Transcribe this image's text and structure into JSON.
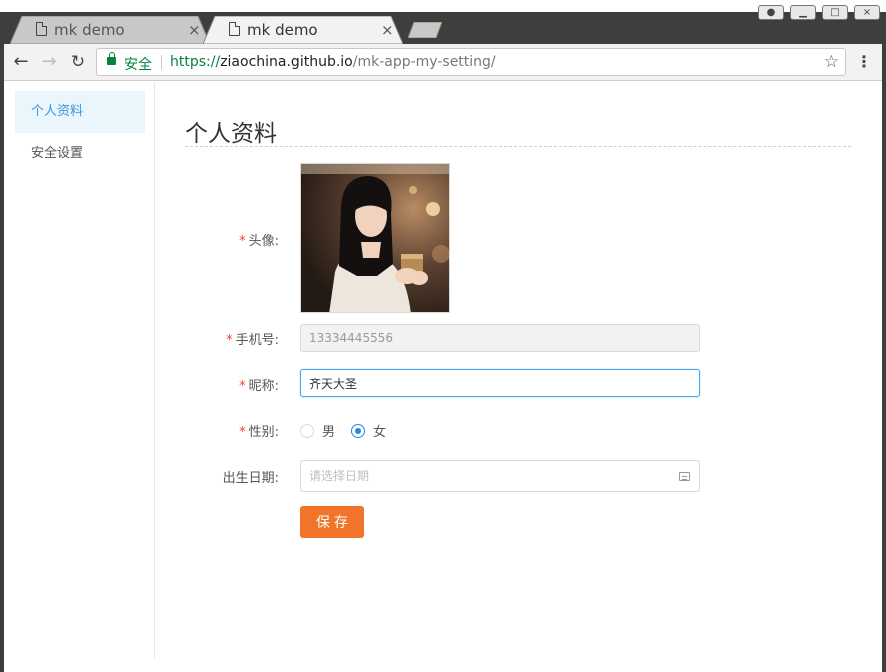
{
  "browser": {
    "tabs": [
      {
        "label": "mk demo",
        "active": false
      },
      {
        "label": "mk demo",
        "active": true
      }
    ],
    "tab_close": "×",
    "secure_label": "安全",
    "url": {
      "scheme": "https://",
      "host": "ziaochina.github.io",
      "path": "/mk-app-my-setting/"
    },
    "nav": {
      "back": "←",
      "forward": "→",
      "reload": "↻",
      "star": "☆",
      "menu": "⋮"
    }
  },
  "sidebar": {
    "items": [
      {
        "label": "个人资料",
        "active": true
      },
      {
        "label": "安全设置",
        "active": false
      }
    ]
  },
  "main": {
    "title": "个人资料",
    "required_mark": "*",
    "avatar": {
      "label": "头像:"
    },
    "phone": {
      "label": "手机号:",
      "value": "13334445556",
      "disabled": true
    },
    "nickname": {
      "label": "昵称:",
      "value": "齐天大圣"
    },
    "gender": {
      "label": "性别:",
      "options": [
        {
          "label": "男",
          "checked": false
        },
        {
          "label": "女",
          "checked": true
        }
      ]
    },
    "birthday": {
      "label": "出生日期:",
      "placeholder": "请选择日期"
    },
    "save_label": "保存"
  },
  "colors": {
    "accent": "#3a95dd",
    "active_bg": "#ebf5fc",
    "primary_button": "#f0742a",
    "required": "#f04134",
    "secure_green": "#0b8043",
    "chrome_dark": "#3f3e3c"
  }
}
